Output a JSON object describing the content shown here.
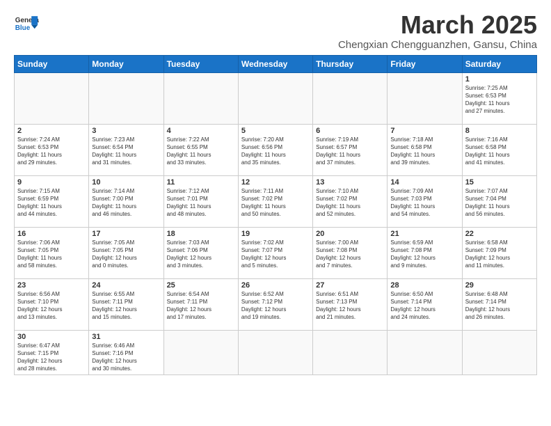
{
  "logo": {
    "text_general": "General",
    "text_blue": "Blue"
  },
  "header": {
    "month_year": "March 2025",
    "location": "Chengxian Chengguanzhen, Gansu, China"
  },
  "weekdays": [
    "Sunday",
    "Monday",
    "Tuesday",
    "Wednesday",
    "Thursday",
    "Friday",
    "Saturday"
  ],
  "weeks": [
    [
      {
        "day": "",
        "info": ""
      },
      {
        "day": "",
        "info": ""
      },
      {
        "day": "",
        "info": ""
      },
      {
        "day": "",
        "info": ""
      },
      {
        "day": "",
        "info": ""
      },
      {
        "day": "",
        "info": ""
      },
      {
        "day": "1",
        "info": "Sunrise: 7:25 AM\nSunset: 6:53 PM\nDaylight: 11 hours\nand 27 minutes."
      }
    ],
    [
      {
        "day": "2",
        "info": "Sunrise: 7:24 AM\nSunset: 6:53 PM\nDaylight: 11 hours\nand 29 minutes."
      },
      {
        "day": "3",
        "info": "Sunrise: 7:23 AM\nSunset: 6:54 PM\nDaylight: 11 hours\nand 31 minutes."
      },
      {
        "day": "4",
        "info": "Sunrise: 7:22 AM\nSunset: 6:55 PM\nDaylight: 11 hours\nand 33 minutes."
      },
      {
        "day": "5",
        "info": "Sunrise: 7:20 AM\nSunset: 6:56 PM\nDaylight: 11 hours\nand 35 minutes."
      },
      {
        "day": "6",
        "info": "Sunrise: 7:19 AM\nSunset: 6:57 PM\nDaylight: 11 hours\nand 37 minutes."
      },
      {
        "day": "7",
        "info": "Sunrise: 7:18 AM\nSunset: 6:58 PM\nDaylight: 11 hours\nand 39 minutes."
      },
      {
        "day": "8",
        "info": "Sunrise: 7:16 AM\nSunset: 6:58 PM\nDaylight: 11 hours\nand 41 minutes."
      }
    ],
    [
      {
        "day": "9",
        "info": "Sunrise: 7:15 AM\nSunset: 6:59 PM\nDaylight: 11 hours\nand 44 minutes."
      },
      {
        "day": "10",
        "info": "Sunrise: 7:14 AM\nSunset: 7:00 PM\nDaylight: 11 hours\nand 46 minutes."
      },
      {
        "day": "11",
        "info": "Sunrise: 7:12 AM\nSunset: 7:01 PM\nDaylight: 11 hours\nand 48 minutes."
      },
      {
        "day": "12",
        "info": "Sunrise: 7:11 AM\nSunset: 7:02 PM\nDaylight: 11 hours\nand 50 minutes."
      },
      {
        "day": "13",
        "info": "Sunrise: 7:10 AM\nSunset: 7:02 PM\nDaylight: 11 hours\nand 52 minutes."
      },
      {
        "day": "14",
        "info": "Sunrise: 7:09 AM\nSunset: 7:03 PM\nDaylight: 11 hours\nand 54 minutes."
      },
      {
        "day": "15",
        "info": "Sunrise: 7:07 AM\nSunset: 7:04 PM\nDaylight: 11 hours\nand 56 minutes."
      }
    ],
    [
      {
        "day": "16",
        "info": "Sunrise: 7:06 AM\nSunset: 7:05 PM\nDaylight: 11 hours\nand 58 minutes."
      },
      {
        "day": "17",
        "info": "Sunrise: 7:05 AM\nSunset: 7:05 PM\nDaylight: 12 hours\nand 0 minutes."
      },
      {
        "day": "18",
        "info": "Sunrise: 7:03 AM\nSunset: 7:06 PM\nDaylight: 12 hours\nand 3 minutes."
      },
      {
        "day": "19",
        "info": "Sunrise: 7:02 AM\nSunset: 7:07 PM\nDaylight: 12 hours\nand 5 minutes."
      },
      {
        "day": "20",
        "info": "Sunrise: 7:00 AM\nSunset: 7:08 PM\nDaylight: 12 hours\nand 7 minutes."
      },
      {
        "day": "21",
        "info": "Sunrise: 6:59 AM\nSunset: 7:08 PM\nDaylight: 12 hours\nand 9 minutes."
      },
      {
        "day": "22",
        "info": "Sunrise: 6:58 AM\nSunset: 7:09 PM\nDaylight: 12 hours\nand 11 minutes."
      }
    ],
    [
      {
        "day": "23",
        "info": "Sunrise: 6:56 AM\nSunset: 7:10 PM\nDaylight: 12 hours\nand 13 minutes."
      },
      {
        "day": "24",
        "info": "Sunrise: 6:55 AM\nSunset: 7:11 PM\nDaylight: 12 hours\nand 15 minutes."
      },
      {
        "day": "25",
        "info": "Sunrise: 6:54 AM\nSunset: 7:11 PM\nDaylight: 12 hours\nand 17 minutes."
      },
      {
        "day": "26",
        "info": "Sunrise: 6:52 AM\nSunset: 7:12 PM\nDaylight: 12 hours\nand 19 minutes."
      },
      {
        "day": "27",
        "info": "Sunrise: 6:51 AM\nSunset: 7:13 PM\nDaylight: 12 hours\nand 21 minutes."
      },
      {
        "day": "28",
        "info": "Sunrise: 6:50 AM\nSunset: 7:14 PM\nDaylight: 12 hours\nand 24 minutes."
      },
      {
        "day": "29",
        "info": "Sunrise: 6:48 AM\nSunset: 7:14 PM\nDaylight: 12 hours\nand 26 minutes."
      }
    ],
    [
      {
        "day": "30",
        "info": "Sunrise: 6:47 AM\nSunset: 7:15 PM\nDaylight: 12 hours\nand 28 minutes."
      },
      {
        "day": "31",
        "info": "Sunrise: 6:46 AM\nSunset: 7:16 PM\nDaylight: 12 hours\nand 30 minutes."
      },
      {
        "day": "",
        "info": ""
      },
      {
        "day": "",
        "info": ""
      },
      {
        "day": "",
        "info": ""
      },
      {
        "day": "",
        "info": ""
      },
      {
        "day": "",
        "info": ""
      }
    ]
  ]
}
